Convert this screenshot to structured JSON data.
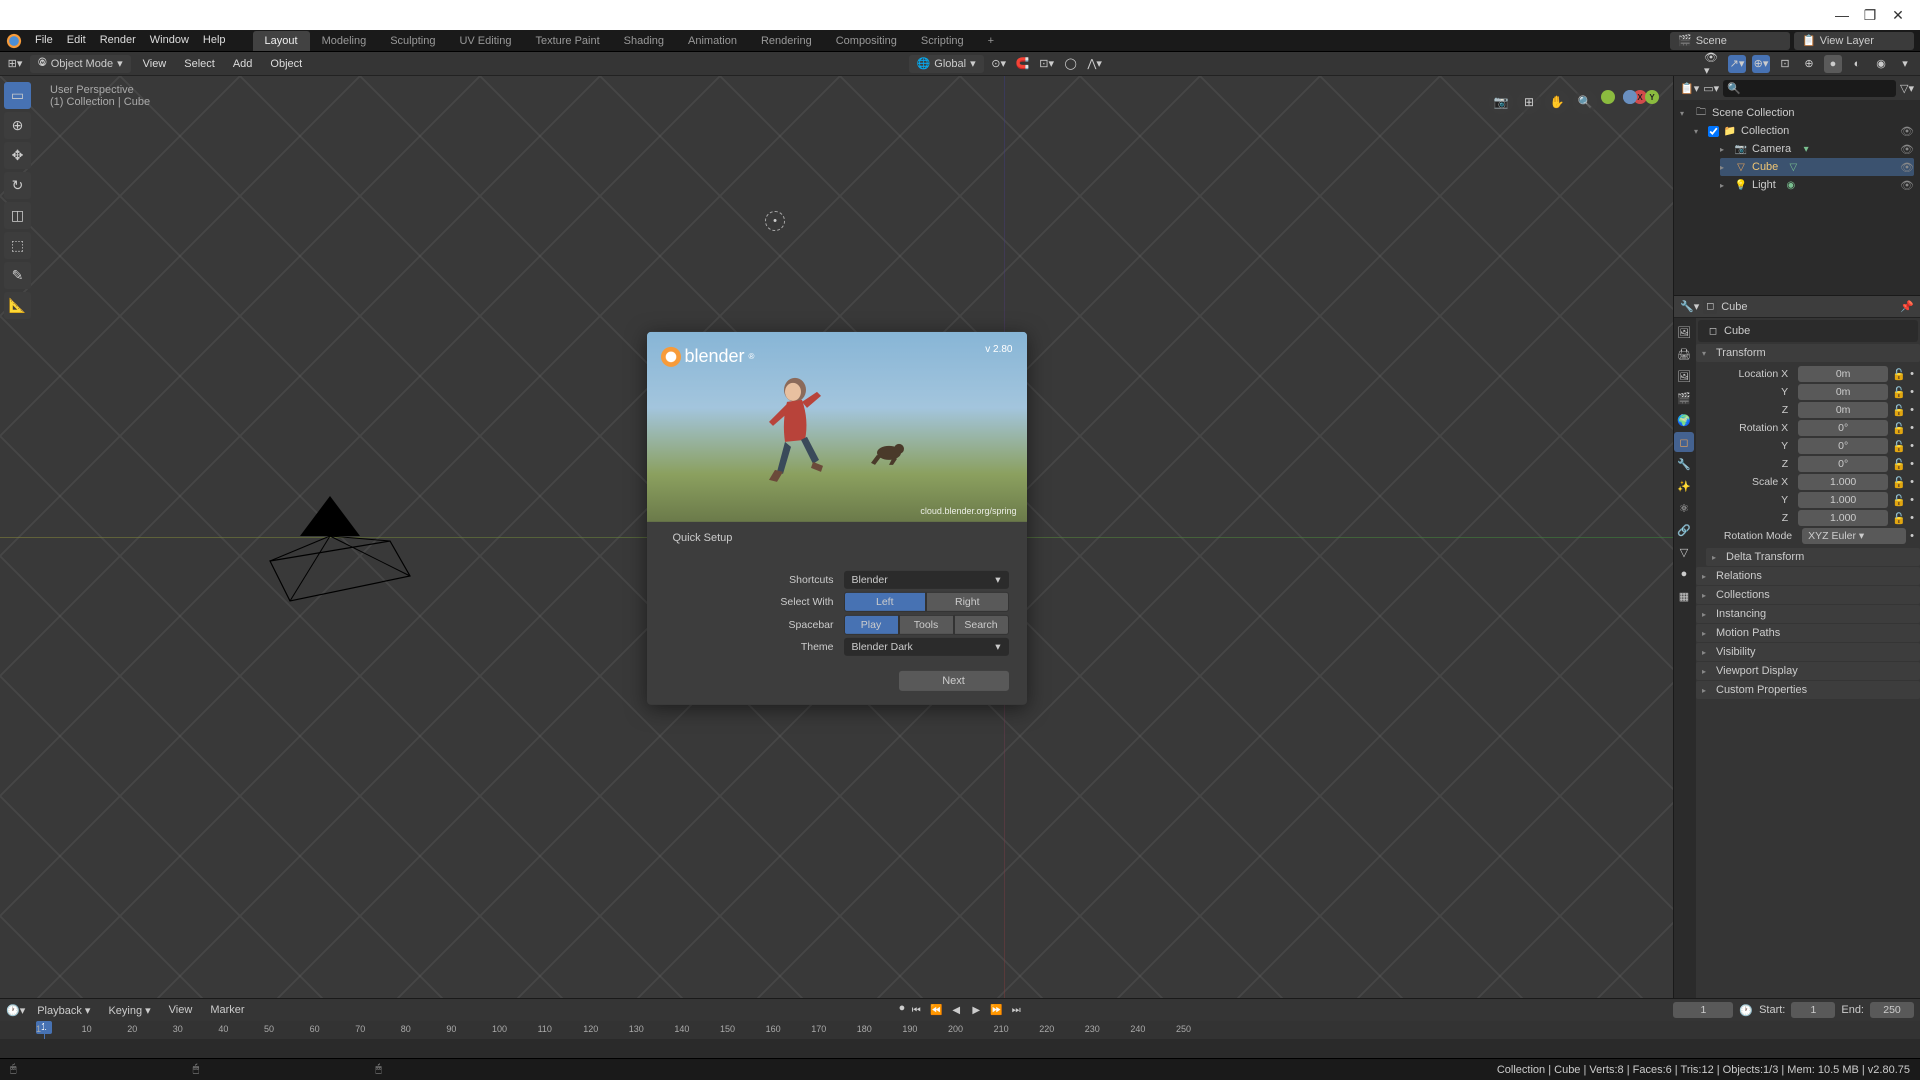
{
  "window": {
    "minimize": "—",
    "maximize": "❐",
    "close": "✕"
  },
  "menu": [
    "File",
    "Edit",
    "Render",
    "Window",
    "Help"
  ],
  "workspaces": [
    "Layout",
    "Modeling",
    "Sculpting",
    "UV Editing",
    "Texture Paint",
    "Shading",
    "Animation",
    "Rendering",
    "Compositing",
    "Scripting"
  ],
  "scene_label": "Scene",
  "viewlayer_label": "View Layer",
  "header": {
    "mode": "Object Mode",
    "menus": [
      "View",
      "Select",
      "Add",
      "Object"
    ],
    "orientation": "Global"
  },
  "overlay": {
    "line1": "User Perspective",
    "line2": "(1) Collection | Cube"
  },
  "tools": [
    "▭",
    "⊕",
    "✥",
    "↻",
    "◫",
    "⬚",
    "✎",
    "📐"
  ],
  "gizmo": {
    "x": "X",
    "y": "Y",
    "z": "Z"
  },
  "outliner": {
    "root": "Scene Collection",
    "items": [
      {
        "name": "Collection",
        "icon": "📁",
        "expanded": true,
        "children": [
          {
            "name": "Camera",
            "icon": "📷"
          },
          {
            "name": "Cube",
            "icon": "▨",
            "active": true
          },
          {
            "name": "Light",
            "icon": "💡"
          }
        ]
      }
    ]
  },
  "props": {
    "object": "Cube",
    "transform_label": "Transform",
    "loc": {
      "label": "Location",
      "x": "0m",
      "y": "0m",
      "z": "0m"
    },
    "rot": {
      "label": "Rotation",
      "x": "0°",
      "y": "0°",
      "z": "0°"
    },
    "scale": {
      "label": "Scale",
      "x": "1.000",
      "y": "1.000",
      "z": "1.000"
    },
    "rotmode": {
      "label": "Rotation Mode",
      "value": "XYZ Euler"
    },
    "sections": [
      "Delta Transform",
      "Relations",
      "Collections",
      "Instancing",
      "Motion Paths",
      "Visibility",
      "Viewport Display",
      "Custom Properties"
    ]
  },
  "splash": {
    "brand": "blender",
    "version": "v 2.80",
    "credit": "cloud.blender.org/spring",
    "title": "Quick Setup",
    "shortcuts": {
      "label": "Shortcuts",
      "value": "Blender"
    },
    "selectwith": {
      "label": "Select With",
      "options": [
        "Left",
        "Right"
      ],
      "active": 0
    },
    "spacebar": {
      "label": "Spacebar",
      "options": [
        "Play",
        "Tools",
        "Search"
      ],
      "active": 0
    },
    "theme": {
      "label": "Theme",
      "value": "Blender Dark"
    },
    "next": "Next"
  },
  "timeline": {
    "menus": [
      "Playback",
      "Keying",
      "View",
      "Marker"
    ],
    "current": 1,
    "start": 1,
    "end": 250,
    "start_label": "Start:",
    "end_label": "End:",
    "ticks": [
      1,
      10,
      20,
      30,
      40,
      50,
      60,
      70,
      80,
      90,
      100,
      110,
      120,
      130,
      140,
      150,
      160,
      170,
      180,
      190,
      200,
      210,
      220,
      230,
      240,
      250
    ]
  },
  "status": "Collection | Cube | Verts:8 | Faces:6 | Tris:12 | Objects:1/3 | Mem: 10.5 MB | v2.80.75"
}
